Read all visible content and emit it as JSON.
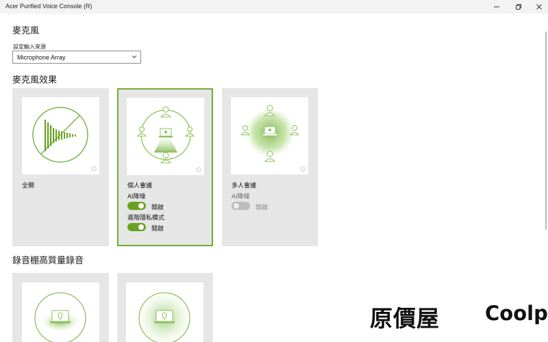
{
  "window": {
    "title": "Acer Purified Voice Console (R)",
    "minimize_glyph": "—",
    "maximize_glyph": "⧉",
    "close_glyph": "✕"
  },
  "microphone": {
    "title": "麥克風",
    "source_label": "設定輸入來源",
    "source_value": "Microphone Array"
  },
  "effects": {
    "title": "麥克風效果",
    "cards": [
      {
        "title": "全關",
        "selected": false
      },
      {
        "title": "個人會議",
        "selected": true,
        "options": [
          {
            "label": "AI降噪",
            "state": "開啟",
            "on": true
          },
          {
            "label": "進階隱私模式",
            "state": "開啟",
            "on": true
          }
        ]
      },
      {
        "title": "多人會議",
        "selected": false,
        "options": [
          {
            "label": "AI降噪",
            "state": "開啟",
            "on": false,
            "disabled": true
          }
        ]
      }
    ]
  },
  "recording": {
    "title": "錄音棚高質量錄音"
  },
  "watermark": {
    "text_cn": "原價屋",
    "text_en": "Coolpc"
  },
  "colors": {
    "accent": "#6aa122",
    "selected_border": "#6dac2e",
    "card_bg": "#e6e6e6",
    "toggle_off": "#bcbcbc"
  },
  "icons": {
    "dropdown": "chevron-down-icon",
    "info": "info-icon",
    "minimize": "minimize-icon",
    "maximize": "restore-icon",
    "close": "close-icon"
  }
}
